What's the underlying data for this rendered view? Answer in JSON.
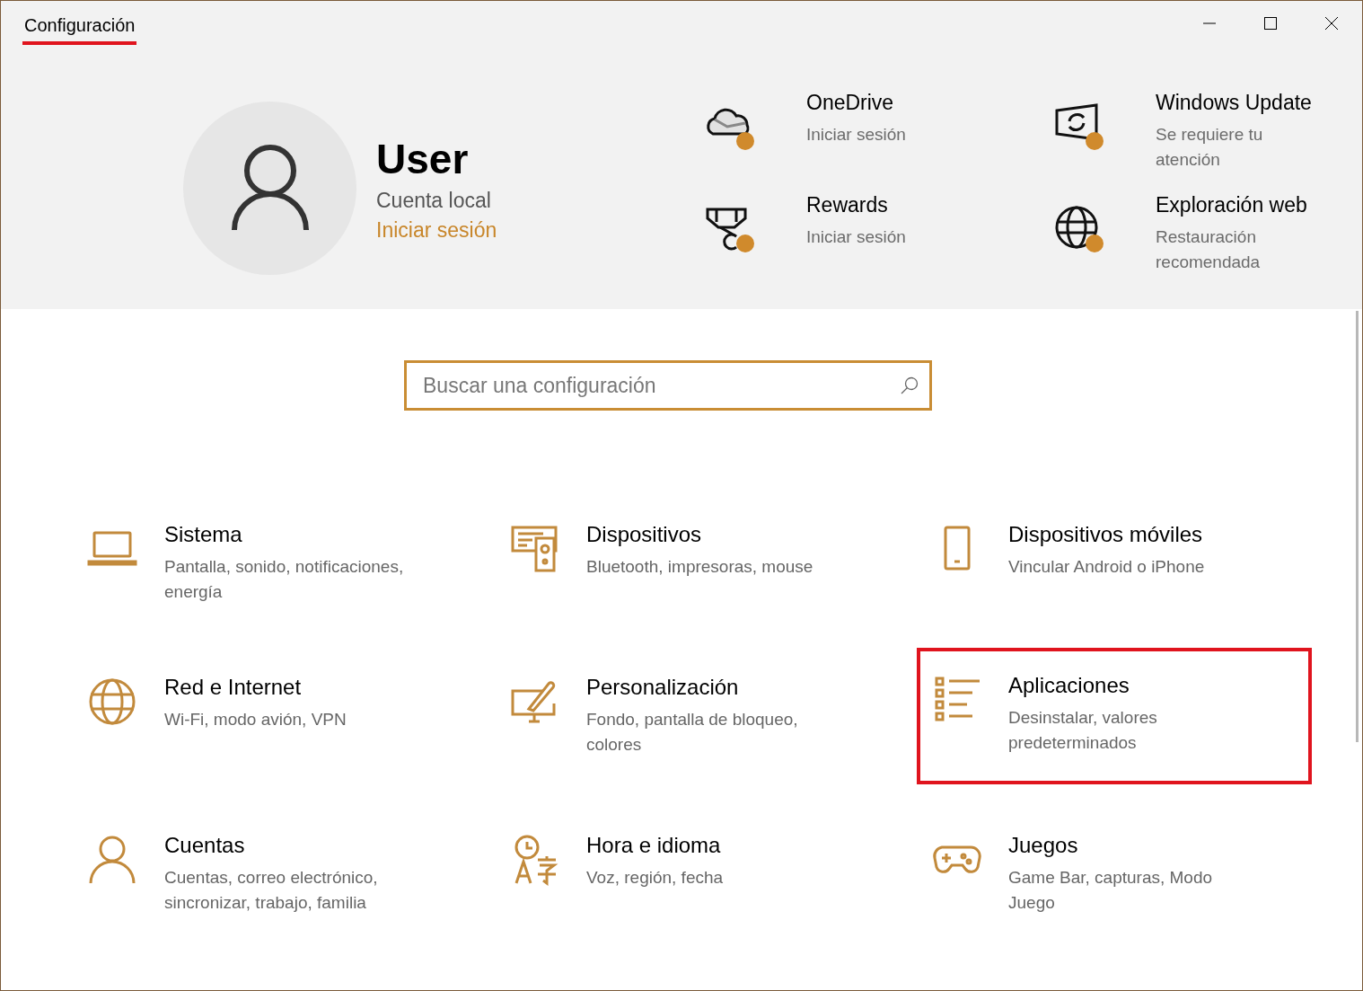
{
  "window": {
    "title": "Configuración",
    "title_marked": true
  },
  "user": {
    "name": "User",
    "account_type": "Cuenta local",
    "sign_in_link": "Iniciar sesión"
  },
  "services": [
    {
      "name": "OneDrive",
      "status": "Iniciar sesión",
      "alert": true
    },
    {
      "name": "Windows Update",
      "status": "Se requiere tu atención",
      "alert": true
    },
    {
      "name": "Rewards",
      "status": "Iniciar sesión",
      "alert": true
    },
    {
      "name": "Exploración web",
      "status": "Restauración recomendada",
      "alert": true
    }
  ],
  "search": {
    "placeholder": "Buscar una configuración"
  },
  "categories": [
    {
      "title": "Sistema",
      "description": "Pantalla, sonido, notificaciones, energía",
      "highlighted": false
    },
    {
      "title": "Dispositivos",
      "description": "Bluetooth, impresoras, mouse",
      "highlighted": false
    },
    {
      "title": "Dispositivos móviles",
      "description": "Vincular Android o iPhone",
      "highlighted": false
    },
    {
      "title": "Red e Internet",
      "description": "Wi-Fi, modo avión, VPN",
      "highlighted": false
    },
    {
      "title": "Personalización",
      "description": "Fondo, pantalla de bloqueo, colores",
      "highlighted": false
    },
    {
      "title": "Aplicaciones",
      "description": "Desinstalar, valores predeterminados",
      "highlighted": true
    },
    {
      "title": "Cuentas",
      "description": "Cuentas, correo electrónico, sincronizar, trabajo, familia",
      "highlighted": false
    },
    {
      "title": "Hora e idioma",
      "description": "Voz, región, fecha",
      "highlighted": false
    },
    {
      "title": "Juegos",
      "description": "Game Bar, capturas, Modo Juego",
      "highlighted": false
    }
  ]
}
